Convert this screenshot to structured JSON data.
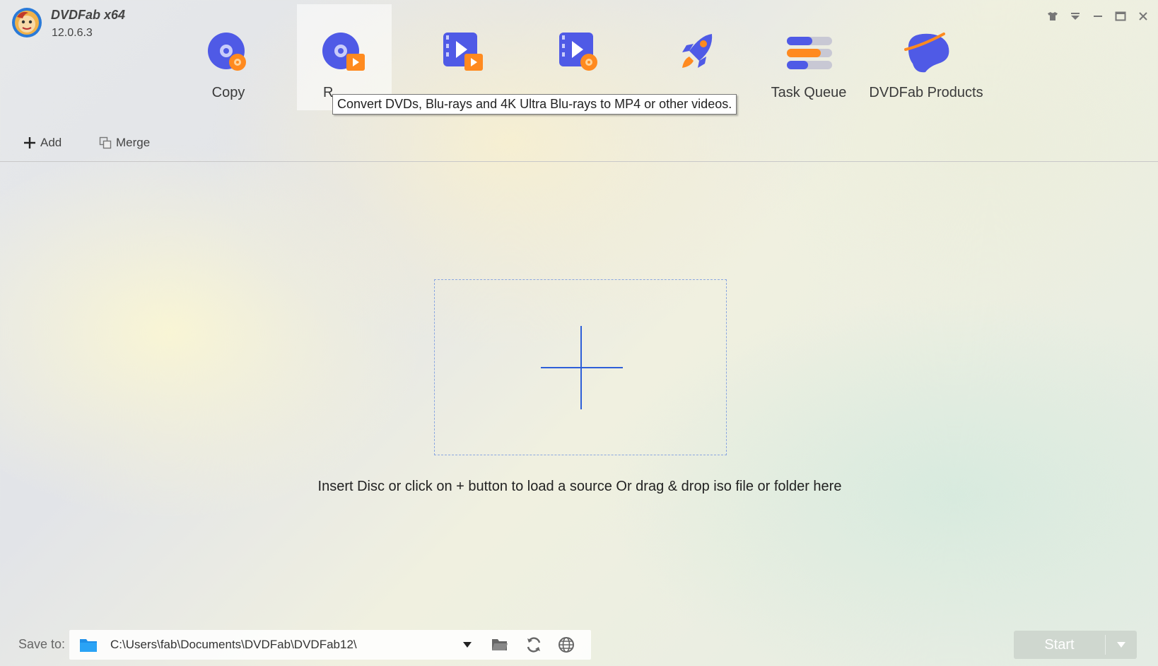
{
  "app": {
    "name": "DVDFab x64",
    "version": "12.0.6.3"
  },
  "modules": [
    {
      "label": "Copy",
      "icon": "disc-copy-icon"
    },
    {
      "label": "R",
      "icon": "disc-ripper-icon"
    },
    {
      "label": "",
      "icon": "video-converter-icon"
    },
    {
      "label": "",
      "icon": "video-creator-icon"
    },
    {
      "label": "",
      "icon": "rocket-icon"
    },
    {
      "label": "Task Queue",
      "icon": "task-queue-icon"
    },
    {
      "label": "DVDFab Products",
      "icon": "dvdfab-products-icon"
    }
  ],
  "tooltip": "Convert DVDs, Blu-rays and 4K Ultra Blu-rays to MP4 or other videos.",
  "toolbar": {
    "add_label": "Add",
    "merge_label": "Merge"
  },
  "main": {
    "hint": "Insert Disc or click on + button to load a source Or drag & drop iso file or folder here"
  },
  "save": {
    "label": "Save to:",
    "path": "C:\\Users\\fab\\Documents\\DVDFab\\DVDFab12\\"
  },
  "start": {
    "label": "Start"
  },
  "colors": {
    "accent": "#2e5fd8",
    "icon_blue": "#4f5ae6",
    "icon_orange": "#ff8a1f",
    "start_bg": "#cfd7cf"
  }
}
